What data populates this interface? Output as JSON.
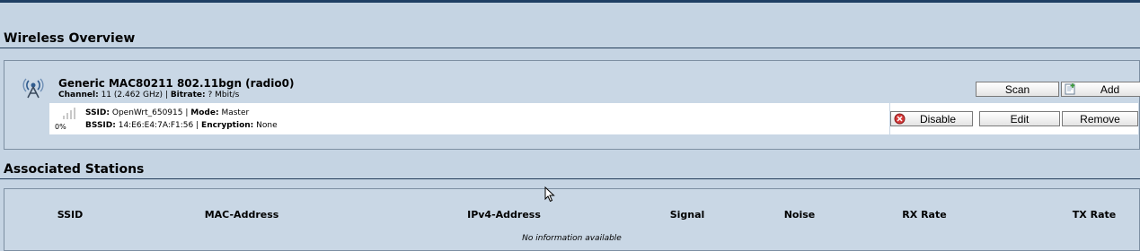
{
  "overview": {
    "title": "Wireless Overview",
    "device": {
      "name": "Generic MAC80211 802.11bgn (radio0)",
      "channel_label": "Channel:",
      "channel_value": "11 (2.462 GHz)",
      "bitrate_label": "Bitrate:",
      "bitrate_value": "? Mbit/s",
      "separator": "|",
      "scan_label": "Scan",
      "add_label": "Add"
    },
    "network": {
      "signal_percent": "0%",
      "ssid_label": "SSID:",
      "ssid_value": "OpenWrt_650915",
      "mode_label": "Mode:",
      "mode_value": "Master",
      "bssid_label": "BSSID:",
      "bssid_value": "14:E6:E4:7A:F1:56",
      "encryption_label": "Encryption:",
      "encryption_value": "None",
      "disable_label": "Disable",
      "edit_label": "Edit",
      "remove_label": "Remove"
    }
  },
  "stations": {
    "title": "Associated Stations",
    "columns": [
      "SSID",
      "MAC-Address",
      "IPv4-Address",
      "Signal",
      "Noise",
      "RX Rate",
      "TX Rate"
    ],
    "empty_message": "No information available"
  },
  "colors": {
    "background": "#c5d4e3",
    "rule": "#243d5a",
    "disable_icon": "#d63a3a"
  }
}
